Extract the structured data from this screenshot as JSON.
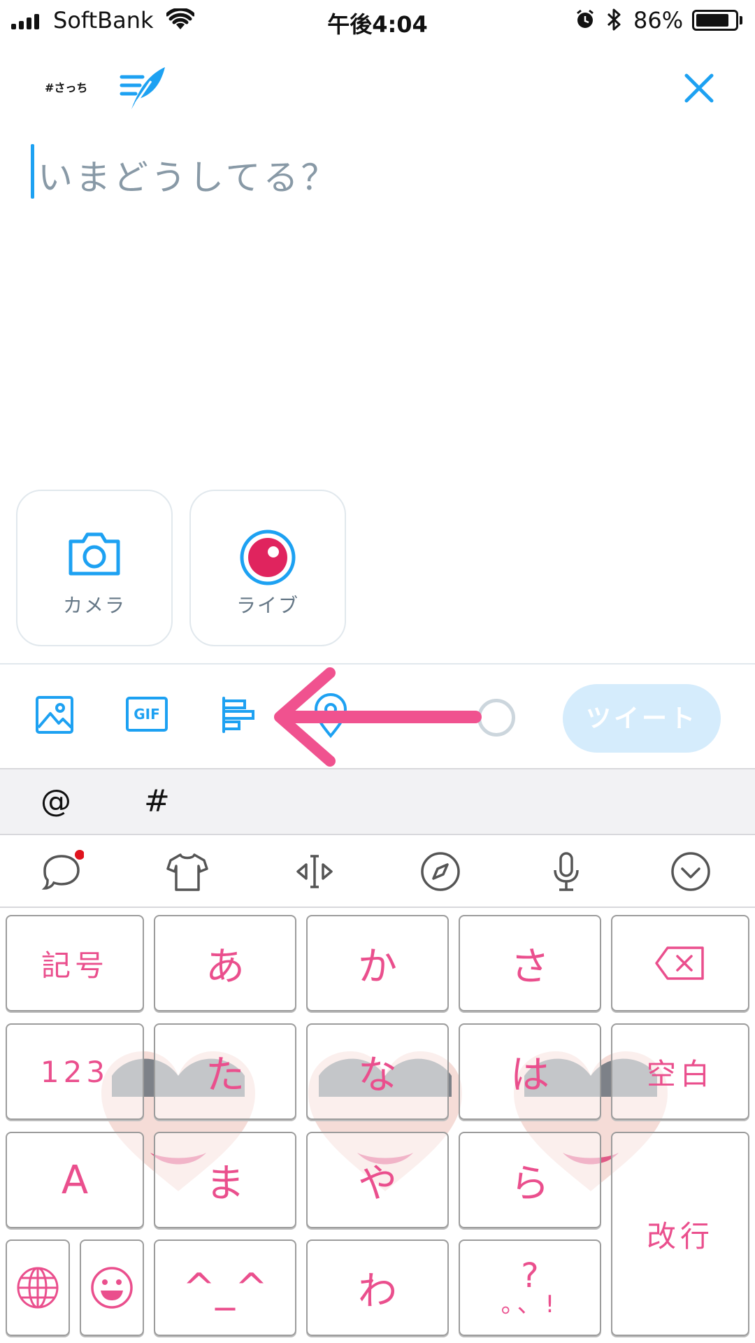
{
  "status_bar": {
    "carrier": "SoftBank",
    "time": "午後4:04",
    "battery_percent": "86%",
    "battery_level": 0.86
  },
  "compose": {
    "account_tag": "#さっち",
    "placeholder": "いまどうしてる？",
    "close_icon": "close-icon",
    "quill_icon": "quill-icon"
  },
  "media": {
    "camera_label": "カメラ",
    "live_label": "ライブ"
  },
  "toolbar": {
    "gif_label": "GIF",
    "tweet_label": "ツイート",
    "accent_color": "#1da1f2",
    "arrow_color": "#f0528f"
  },
  "symbol_bar": {
    "at": "@",
    "hash": "#"
  },
  "keyboard": {
    "row1": [
      "記号",
      "あ",
      "か",
      "さ"
    ],
    "row2": [
      "123",
      "た",
      "な",
      "は",
      "空白"
    ],
    "row3": [
      "A",
      "ま",
      "や",
      "ら"
    ],
    "enter": "改行",
    "row4_kaomoji": "^_^",
    "row4_wa": "わ",
    "punct_top": "?",
    "punct_bottom": "。、!",
    "key_text_color": "#ea4f8d"
  }
}
